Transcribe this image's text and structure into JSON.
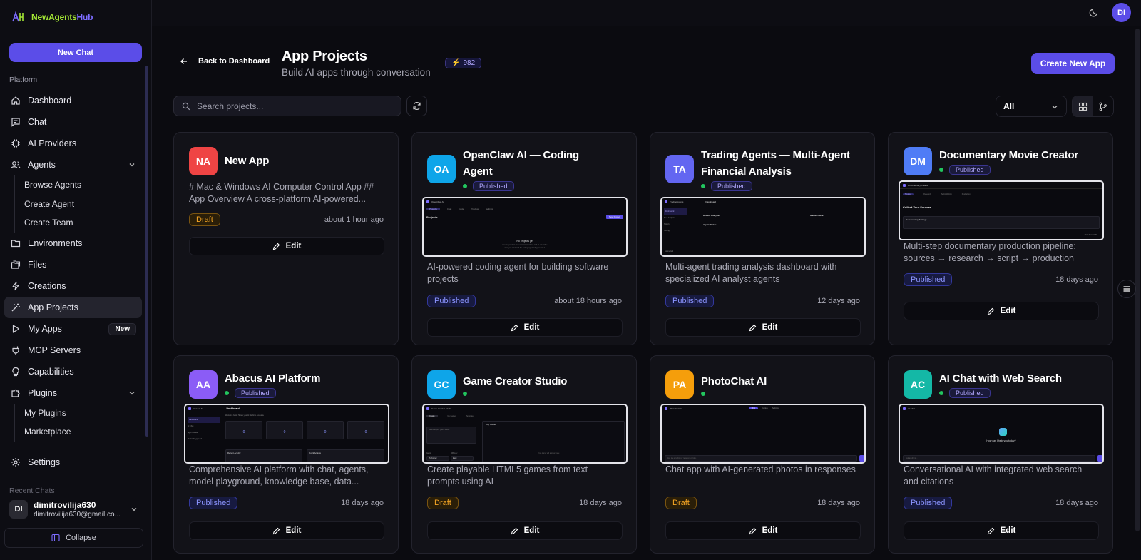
{
  "app": {
    "name_a": "NewAgents",
    "name_b": "Hub"
  },
  "sidebar": {
    "new_chat": "New Chat",
    "section": "Platform",
    "items": [
      {
        "label": "Dashboard",
        "icon": "home-icon"
      },
      {
        "label": "Chat",
        "icon": "chat-icon"
      },
      {
        "label": "AI Providers",
        "icon": "cpu-icon"
      },
      {
        "label": "Agents",
        "icon": "users-icon"
      },
      {
        "label": "Browse Agents"
      },
      {
        "label": "Create Agent"
      },
      {
        "label": "Create Team"
      },
      {
        "label": "Environments",
        "icon": "folder-icon"
      },
      {
        "label": "Files",
        "icon": "files-icon"
      },
      {
        "label": "Creations",
        "icon": "bolt-icon"
      },
      {
        "label": "App Projects",
        "icon": "wand-icon"
      },
      {
        "label": "My Apps",
        "icon": "play-icon",
        "badge": "New"
      },
      {
        "label": "MCP Servers",
        "icon": "plug-icon"
      },
      {
        "label": "Capabilities",
        "icon": "bulb-icon"
      },
      {
        "label": "Plugins",
        "icon": "puzzle-icon"
      },
      {
        "label": "My Plugins"
      },
      {
        "label": "Marketplace"
      },
      {
        "label": "Settings",
        "icon": "gear-icon"
      }
    ],
    "recent": "Recent Chats",
    "user": {
      "initials": "DI",
      "name": "dimitrovilija630",
      "email": "dimitrovilija630@gmail.co..."
    },
    "collapse": "Collapse"
  },
  "topbar": {
    "avatar": "DI"
  },
  "header": {
    "back": "Back to Dashboard",
    "title": "App Projects",
    "subtitle": "Build AI apps through conversation",
    "credits": "982",
    "create": "Create New App"
  },
  "toolbar": {
    "search_placeholder": "Search projects...",
    "filter": "All"
  },
  "cards": [
    {
      "initials": "NA",
      "title": "New App",
      "desc": "# Mac & Windows AI Computer Control App ## App Overview A cross-platform AI-powered...",
      "badge": "Draft",
      "time": "about 1 hour ago",
      "edit": "Edit",
      "color": "#ef4444"
    },
    {
      "initials": "OA",
      "title": "OpenClaw AI — Coding Agent",
      "pill": "Published",
      "desc": "AI-powered coding agent for building software projects",
      "badge": "Published",
      "time": "about 18 hours ago",
      "edit": "Edit",
      "color": "#0ea5e9"
    },
    {
      "initials": "TA",
      "title": "Trading Agents — Multi-Agent Financial Analysis",
      "pill": "Published",
      "desc": "Multi-agent trading analysis dashboard with specialized AI analyst agents",
      "badge": "Published",
      "time": "12 days ago",
      "edit": "Edit",
      "color": "#6366f1"
    },
    {
      "initials": "DM",
      "title": "Documentary Movie Creator",
      "pill": "Published",
      "desc": "Multi-step documentary production pipeline: sources → research → script → production",
      "badge": "Published",
      "time": "18 days ago",
      "edit": "Edit",
      "color": "#4f7cf6"
    },
    {
      "initials": "AA",
      "title": "Abacus AI Platform",
      "pill": "Published",
      "desc": "Comprehensive AI platform with chat, agents, model playground, knowledge base, data...",
      "badge": "Published",
      "time": "18 days ago",
      "edit": "Edit",
      "color": "#8b5cf6"
    },
    {
      "initials": "GC",
      "title": "Game Creator Studio",
      "desc": "Create playable HTML5 games from text prompts using AI",
      "badge": "Draft",
      "time": "18 days ago",
      "edit": "Edit",
      "color": "#0ea5e9"
    },
    {
      "initials": "PA",
      "title": "PhotoChat AI",
      "desc": "Chat app with AI-generated photos in responses",
      "badge": "Draft",
      "time": "18 days ago",
      "edit": "Edit",
      "color": "#f59e0b"
    },
    {
      "initials": "AC",
      "title": "AI Chat with Web Search",
      "pill": "Published",
      "desc": "Conversational AI with integrated web search and citations",
      "badge": "Published",
      "time": "18 days ago",
      "edit": "Edit",
      "color": "#14b8a6"
    }
  ],
  "previews": {
    "p1": {
      "logo": "OpenClaw AI",
      "tab1": "Projects",
      "tab2": "Chat",
      "tab3": "Code",
      "tab4": "Preview",
      "tab5": "Settings",
      "heading": "Projects",
      "btn": "New Project",
      "empty": "No projects yet",
      "hint": "Create your first project to start building with AI. Describe what you want and the coding agent will generate it."
    },
    "p2": {
      "logo": "TradingAgents",
      "title": "Dashboard",
      "col1": "Recent Analyses",
      "col2": "Market Pulse",
      "col3": "Agent Status",
      "nav1": "Dashboard",
      "nav2": "New Analysis",
      "nav3": "History",
      "nav4": "Settings",
      "foot": "Connected"
    },
    "p3": {
      "logo": "Documentary Creator",
      "h": "Collect Your Sources",
      "s": "Documentary Settings",
      "foot": "Gather source material and references for your documentary",
      "t1": "Sources",
      "t2": "Research",
      "t3": "Script Writing",
      "t4": "Production",
      "btn": "Next: Research"
    },
    "p4": {
      "logo": "Abacus AI",
      "title": "Dashboard",
      "sub": "Welcome back. Here's your AI platform overview.",
      "stat": "0",
      "s1": "Total Conversations",
      "s2": "AI Agents",
      "s3": "Knowledge Bases",
      "s4": "Models Available",
      "n1": "Dashboard",
      "n2": "AI Chat",
      "n3": "Agent Builder",
      "n4": "Model Playground",
      "r": "Recent Activity",
      "q": "Quick Actions"
    },
    "p5": {
      "logo": "Game Creator Studio",
      "tab1": "Create",
      "tab2": "My Games",
      "tab3": "Templates",
      "game": "My Game",
      "l1": "Genre",
      "l2": "Difficulty",
      "v1": "Platformer",
      "v2": "Easy",
      "empty": "Your game will appear here",
      "prompt": "Describe your game idea..."
    },
    "p6": {
      "logo": "PhotoChat AI",
      "tab1": "Chat",
      "tab2": "Gallery",
      "tab3": "Settings",
      "input": "Ask me anything or request a photo..."
    },
    "p7": {
      "logo": "AI Chat",
      "q": "How can I help you today?",
      "input": "Ask anything..."
    }
  }
}
